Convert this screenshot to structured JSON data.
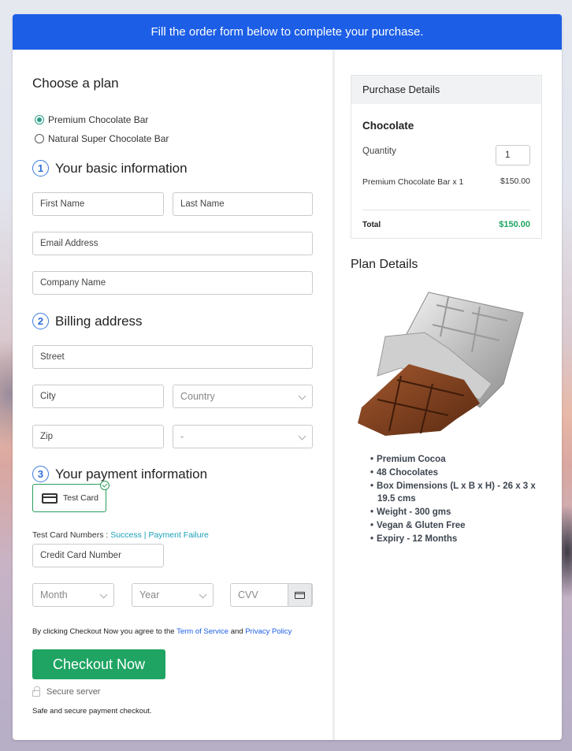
{
  "banner": {
    "text": "Fill the order form below to complete your purchase."
  },
  "plan": {
    "heading": "Choose a plan",
    "options": [
      {
        "label": "Premium Chocolate Bar",
        "selected": true
      },
      {
        "label": "Natural Super Chocolate Bar",
        "selected": false
      }
    ]
  },
  "basic": {
    "number": "1",
    "heading": "Your basic information",
    "first_name": "First Name",
    "last_name": "Last Name",
    "email": "Email Address",
    "company": "Company Name"
  },
  "billing": {
    "number": "2",
    "heading": "Billing address",
    "street": "Street",
    "city": "City",
    "country": "Country",
    "zip": "Zip",
    "state": "-"
  },
  "payment": {
    "number": "3",
    "heading": "Your payment information",
    "method": "Test Card",
    "test_numbers_label": "Test Card Numbers : ",
    "success_link": "Success",
    "separator": " | ",
    "failure_link": "Payment Failure",
    "card_number": "Credit Card Number",
    "month": "Month",
    "year": "Year",
    "cvv": "CVV"
  },
  "agreement": {
    "prefix": "By clicking Checkout Now you agree to the ",
    "tos": "Term of Service",
    "and": " and ",
    "privacy": "Privacy Policy"
  },
  "checkout": {
    "button": "Checkout Now",
    "secure": "Secure server",
    "safe": "Safe and secure payment checkout."
  },
  "purchase": {
    "heading": "Purchase Details",
    "product": "Chocolate",
    "quantity_label": "Quantity",
    "quantity": "1",
    "item": "Premium Chocolate Bar x 1",
    "item_price": "$150.00",
    "total_label": "Total",
    "total": "$150.00",
    "total_color": "#1fa463"
  },
  "plan_details": {
    "heading": "Plan Details",
    "image_alt": "chocolate-bar",
    "features": [
      "Premium Cocoa",
      "48 Chocolates",
      "Box Dimensions (L x B x H) - 26 x 3 x 19.5 cms",
      "Weight - 300 gms",
      "Vegan & Gluten Free",
      "Expiry - 12 Months"
    ]
  },
  "colors": {
    "accent": "#1c5ee6",
    "success": "#1fa463",
    "link": "#1aa0b8"
  }
}
